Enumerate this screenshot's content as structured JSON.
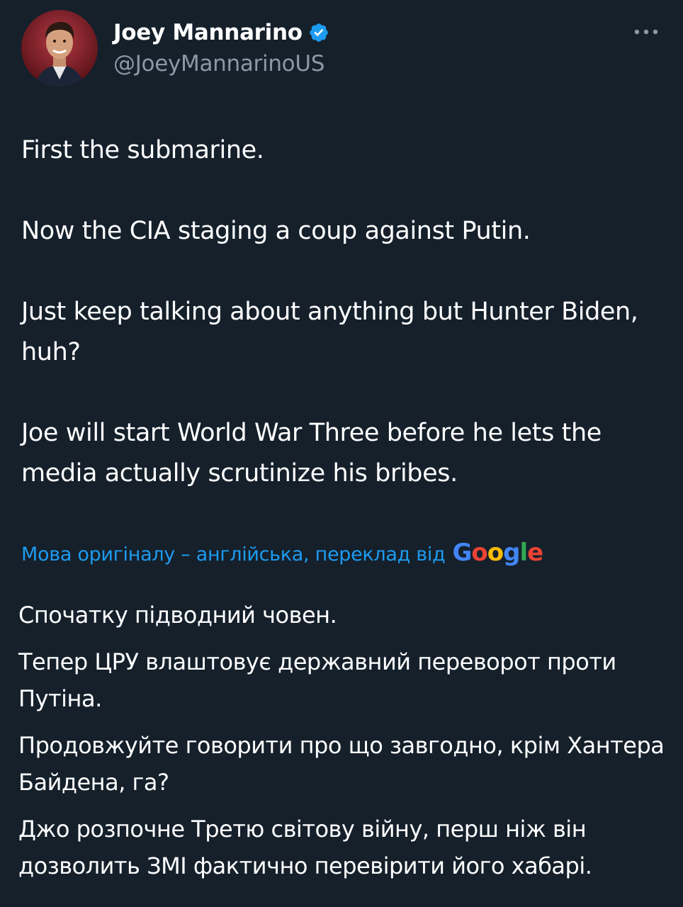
{
  "author": {
    "display_name": "Joey Mannarino",
    "handle": "@JoeyMannarinoUS",
    "verified": true,
    "avatar_icon": "profile-photo"
  },
  "menu_icon": "more-options-icon",
  "tweet": {
    "paragraphs": [
      "First the submarine.",
      "Now the CIA staging a coup against Putin.",
      "Just keep talking about anything but Hunter Biden, huh?",
      "Joe will start World War Three before he lets the media actually scrutinize his bribes."
    ]
  },
  "translation": {
    "note": "Мова оригіналу – англійська, переклад від",
    "provider_letters": [
      "G",
      "o",
      "o",
      "g",
      "l",
      "e"
    ],
    "provider_colors": [
      "#4285f4",
      "#ea4335",
      "#fbbc05",
      "#4285f4",
      "#34a853",
      "#ea4335"
    ],
    "paragraphs": [
      "Спочатку підводний човен.",
      "Тепер ЦРУ влаштовує державний переворот проти Путіна.",
      "Продовжуйте говорити про що завгодно, крім Хантера Байдена, га?",
      "Джо розпочне Третю світову війну, перш ніж він дозволить ЗМІ фактично перевірити його хабарі."
    ]
  },
  "colors": {
    "background": "#15202b",
    "text": "#ffffff",
    "secondary_text": "#8b98a5",
    "link": "#1d9bf0",
    "verified_badge": "#1d9bf0"
  }
}
